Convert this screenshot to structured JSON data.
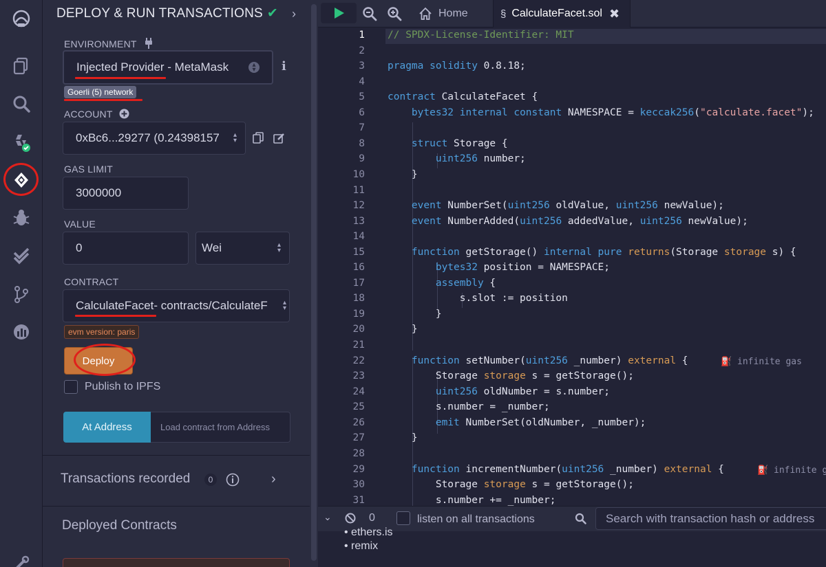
{
  "rail": {
    "icons": [
      "remix-logo-icon",
      "file-explorer-icon",
      "search-icon",
      "solidity-compiler-icon",
      "deploy-run-icon",
      "debugger-icon",
      "test-icon",
      "git-icon",
      "analytics-icon",
      "settings-icon"
    ]
  },
  "panel": {
    "title": "DEPLOY & RUN TRANSACTIONS",
    "environment_label": "ENVIRONMENT",
    "environment_value": "Injected Provider - MetaMask",
    "network_badge": "Goerli (5) network",
    "account_label": "ACCOUNT",
    "account_value": "0xBc6...29277 (0.24398157",
    "gas_limit_label": "GAS LIMIT",
    "gas_limit_value": "3000000",
    "value_label": "VALUE",
    "value_amount": "0",
    "value_unit": "Wei",
    "contract_label": "CONTRACT",
    "contract_value_name": "CalculateFacet",
    "contract_value_path": " - contracts/CalculateF",
    "evm_badge": "evm version: paris",
    "deploy_label": "Deploy",
    "publish_label": "Publish to IPFS",
    "at_address_label": "At Address",
    "load_contract_placeholder": "Load contract from Address",
    "transactions_recorded_label": "Transactions recorded",
    "transactions_recorded_count": "0",
    "deployed_contracts_label": "Deployed Contracts"
  },
  "topbar": {
    "home_tab": "Home",
    "file_tab": "CalculateFacet.sol"
  },
  "editor": {
    "gas_hint_1": "infinite gas",
    "gas_hint_2": "infinite ga"
  },
  "terminal": {
    "pending_count": "0",
    "listen_label": "listen on all transactions",
    "search_placeholder": "Search with transaction hash or address",
    "items": [
      "ethers.js",
      "remix"
    ]
  },
  "colors": {
    "accent_green": "#2ec27e",
    "deploy_orange": "#c97539",
    "at_address_blue": "#2f8fb5",
    "annotation_red": "#e0201b"
  }
}
